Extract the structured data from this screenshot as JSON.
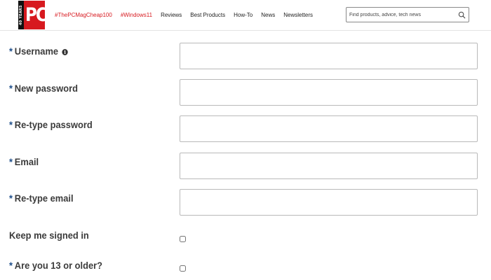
{
  "header": {
    "logo_badge": "40 YEARS",
    "logo_text": "PC",
    "nav": [
      {
        "label": "#ThePCMagCheap100",
        "style": "tag"
      },
      {
        "label": "#Windows11",
        "style": "tag"
      },
      {
        "label": "Reviews",
        "style": "normal"
      },
      {
        "label": "Best Products",
        "style": "normal"
      },
      {
        "label": "How-To",
        "style": "normal"
      },
      {
        "label": "News",
        "style": "normal"
      },
      {
        "label": "Newsletters",
        "style": "normal"
      }
    ],
    "search": {
      "placeholder": "Find products, advice, tech news",
      "value": "",
      "icon": "search-icon"
    }
  },
  "form": {
    "required_marker": "*",
    "fields": [
      {
        "label": "Username",
        "required": true,
        "info_icon": true,
        "value": ""
      },
      {
        "label": "New password",
        "required": true,
        "value": ""
      },
      {
        "label": "Re-type password",
        "required": true,
        "value": ""
      },
      {
        "label": "Email",
        "required": true,
        "value": ""
      },
      {
        "label": "Re-type email",
        "required": true,
        "value": ""
      }
    ],
    "checkboxes": [
      {
        "label": "Keep me signed in",
        "required": false,
        "checked": false
      },
      {
        "label": "Are you 13 or older?",
        "required": true,
        "checked": false
      }
    ]
  },
  "colors": {
    "brand_red": "#d7191f",
    "required_blue": "#1f4f8b",
    "label_gray": "#3b3b3b"
  }
}
